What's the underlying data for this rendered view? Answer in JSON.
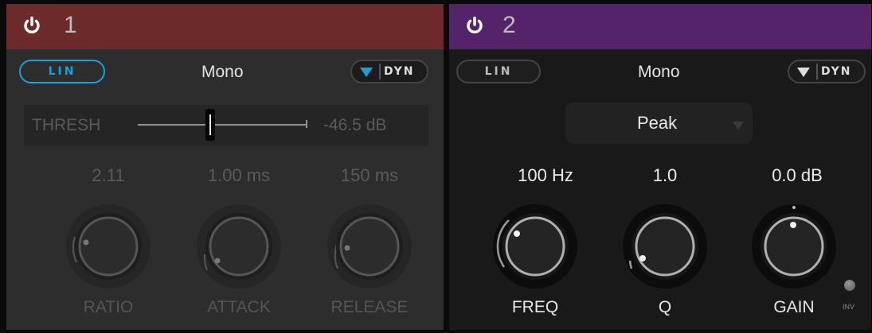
{
  "bands": [
    {
      "number": "1",
      "lin_label": "LIN",
      "channel_mode": "Mono",
      "dyn_label": "DYN",
      "header_color": "#6c2a2b",
      "threshold": {
        "label": "THRESH",
        "value": "-46.5 dB",
        "position": 0.41
      },
      "knobs": [
        {
          "label": "RATIO",
          "value": "2.11"
        },
        {
          "label": "ATTACK",
          "value": "1.00 ms"
        },
        {
          "label": "RELEASE",
          "value": "150 ms"
        }
      ]
    },
    {
      "number": "2",
      "lin_label": "LIN",
      "channel_mode": "Mono",
      "dyn_label": "DYN",
      "header_color": "#54236a",
      "filter_type": "Peak",
      "knobs": [
        {
          "label": "FREQ",
          "value": "100 Hz"
        },
        {
          "label": "Q",
          "value": "1.0"
        },
        {
          "label": "GAIN",
          "value": "0.0 dB"
        }
      ],
      "inv_label": "INV"
    }
  ],
  "accent_color": "#1aa0d8"
}
